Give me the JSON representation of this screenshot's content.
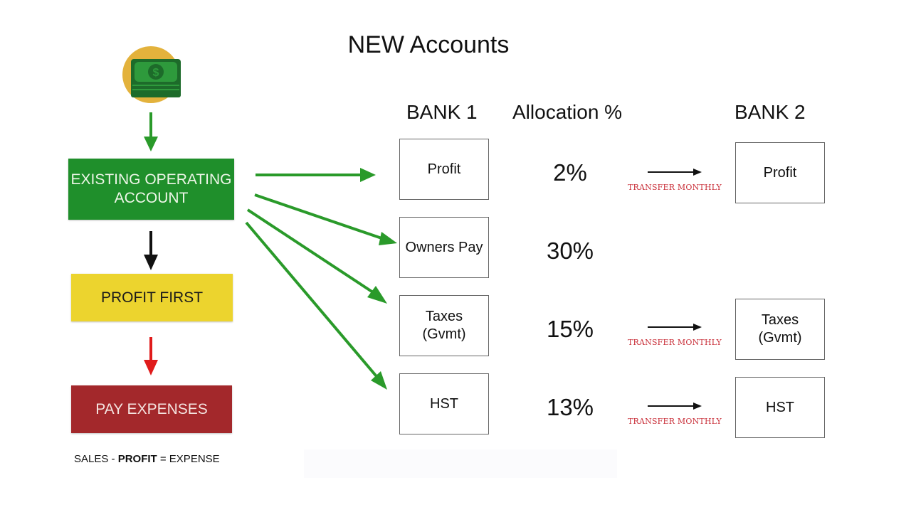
{
  "title": "NEW Accounts",
  "icon": "money-icon",
  "flow": {
    "operating_account": [
      "EXISTING OPERATING",
      "ACCOUNT"
    ],
    "profit_first": "PROFIT FIRST",
    "pay_expenses": "PAY EXPENSES",
    "formula": {
      "sales": "SALES - ",
      "profit": "PROFIT",
      "rest": " = EXPENSE"
    }
  },
  "columns": {
    "bank1": "BANK 1",
    "allocation": "Allocation %",
    "bank2": "BANK 2"
  },
  "accounts": [
    {
      "name": [
        "Profit"
      ],
      "allocation": "2%",
      "transfer": "TRANSFER MONTHLY",
      "bank2": [
        "Profit"
      ]
    },
    {
      "name": [
        "Owners Pay"
      ],
      "allocation": "30%",
      "transfer": null,
      "bank2": null
    },
    {
      "name": [
        "Taxes",
        "(Gvmt)"
      ],
      "allocation": "15%",
      "transfer": "TRANSFER MONTHLY",
      "bank2": [
        "Taxes",
        "(Gvmt)"
      ]
    },
    {
      "name": [
        "HST"
      ],
      "allocation": "13%",
      "transfer": "TRANSFER MONTHLY",
      "bank2": [
        "HST"
      ]
    }
  ],
  "colors": {
    "green": "#1f8f2b",
    "yellow": "#ecd42e",
    "red": "#a3282b",
    "arrow_green": "#2a9a2a",
    "arrow_red": "#e01b1b",
    "transfer_text": "#c9303a"
  }
}
